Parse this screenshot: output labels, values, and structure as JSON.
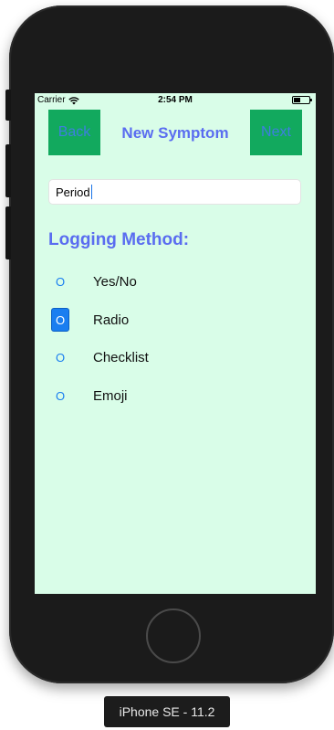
{
  "status_bar": {
    "carrier": "Carrier",
    "time": "2:54 PM"
  },
  "nav": {
    "back_label": "Back",
    "title": "New Symptom",
    "next_label": "Next"
  },
  "symptom_field": {
    "value": "Period"
  },
  "logging": {
    "title": "Logging Method:",
    "options": [
      {
        "mark": "O",
        "label": "Yes/No",
        "selected": false
      },
      {
        "mark": "O",
        "label": "Radio",
        "selected": true
      },
      {
        "mark": "O",
        "label": "Checklist",
        "selected": false
      },
      {
        "mark": "O",
        "label": "Emoji",
        "selected": false
      }
    ]
  },
  "simulator": {
    "device_label": "iPhone SE - 11.2"
  },
  "colors": {
    "screen_bg": "#d9fde8",
    "nav_button_bg": "#12a95e",
    "accent_blue": "#5a6df0",
    "radio_blue": "#1a7ef0",
    "device_body": "#1b1b1b"
  },
  "icons": {
    "wifi": "wifi-icon",
    "battery": "battery-icon",
    "home": "home-button"
  }
}
